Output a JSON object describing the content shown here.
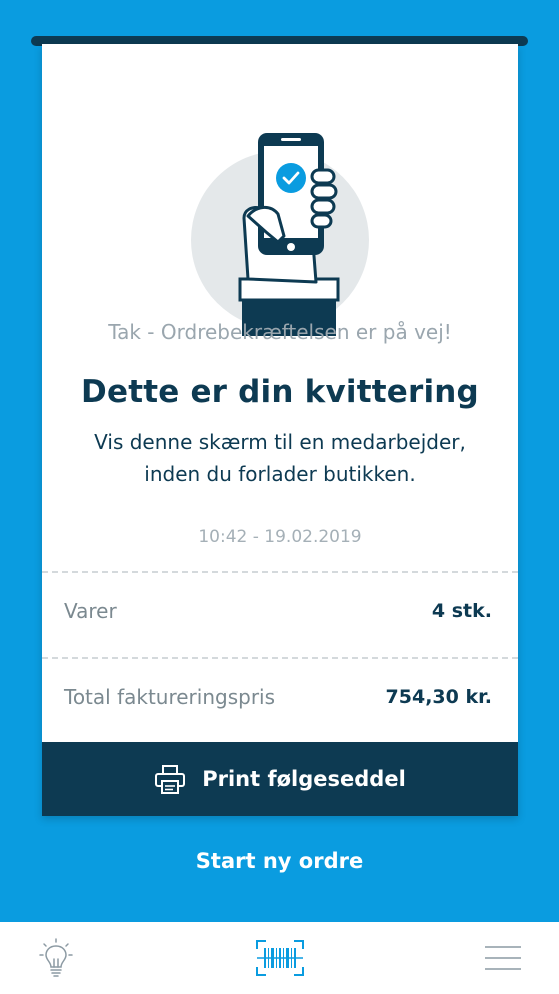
{
  "receipt": {
    "thanks_text": "Tak - Ordrebekræftelsen er på vej!",
    "title": "Dette er din kvittering",
    "instruction_line1": "Vis denne skærm til en medarbejder,",
    "instruction_line2": "inden du forlader butikken.",
    "timestamp": "10:42 - 19.02.2019",
    "rows": [
      {
        "label": "Varer",
        "value": "4 stk."
      },
      {
        "label": "Total faktureringspris",
        "value": "754,30 kr."
      }
    ],
    "print_button_label": "Print følgeseddel",
    "illustration_icon": "hand-holding-phone-checkmark-icon"
  },
  "start_new_order_label": "Start ny ordre",
  "tabbar": {
    "items": [
      {
        "icon": "lightbulb-icon"
      },
      {
        "icon": "barcode-scanner-icon"
      },
      {
        "icon": "menu-icon"
      }
    ]
  },
  "colors": {
    "background": "#0a9ce0",
    "navy": "#0d3a52",
    "accent_blue": "#0a9ce0",
    "muted_text": "#9aa6ae"
  }
}
